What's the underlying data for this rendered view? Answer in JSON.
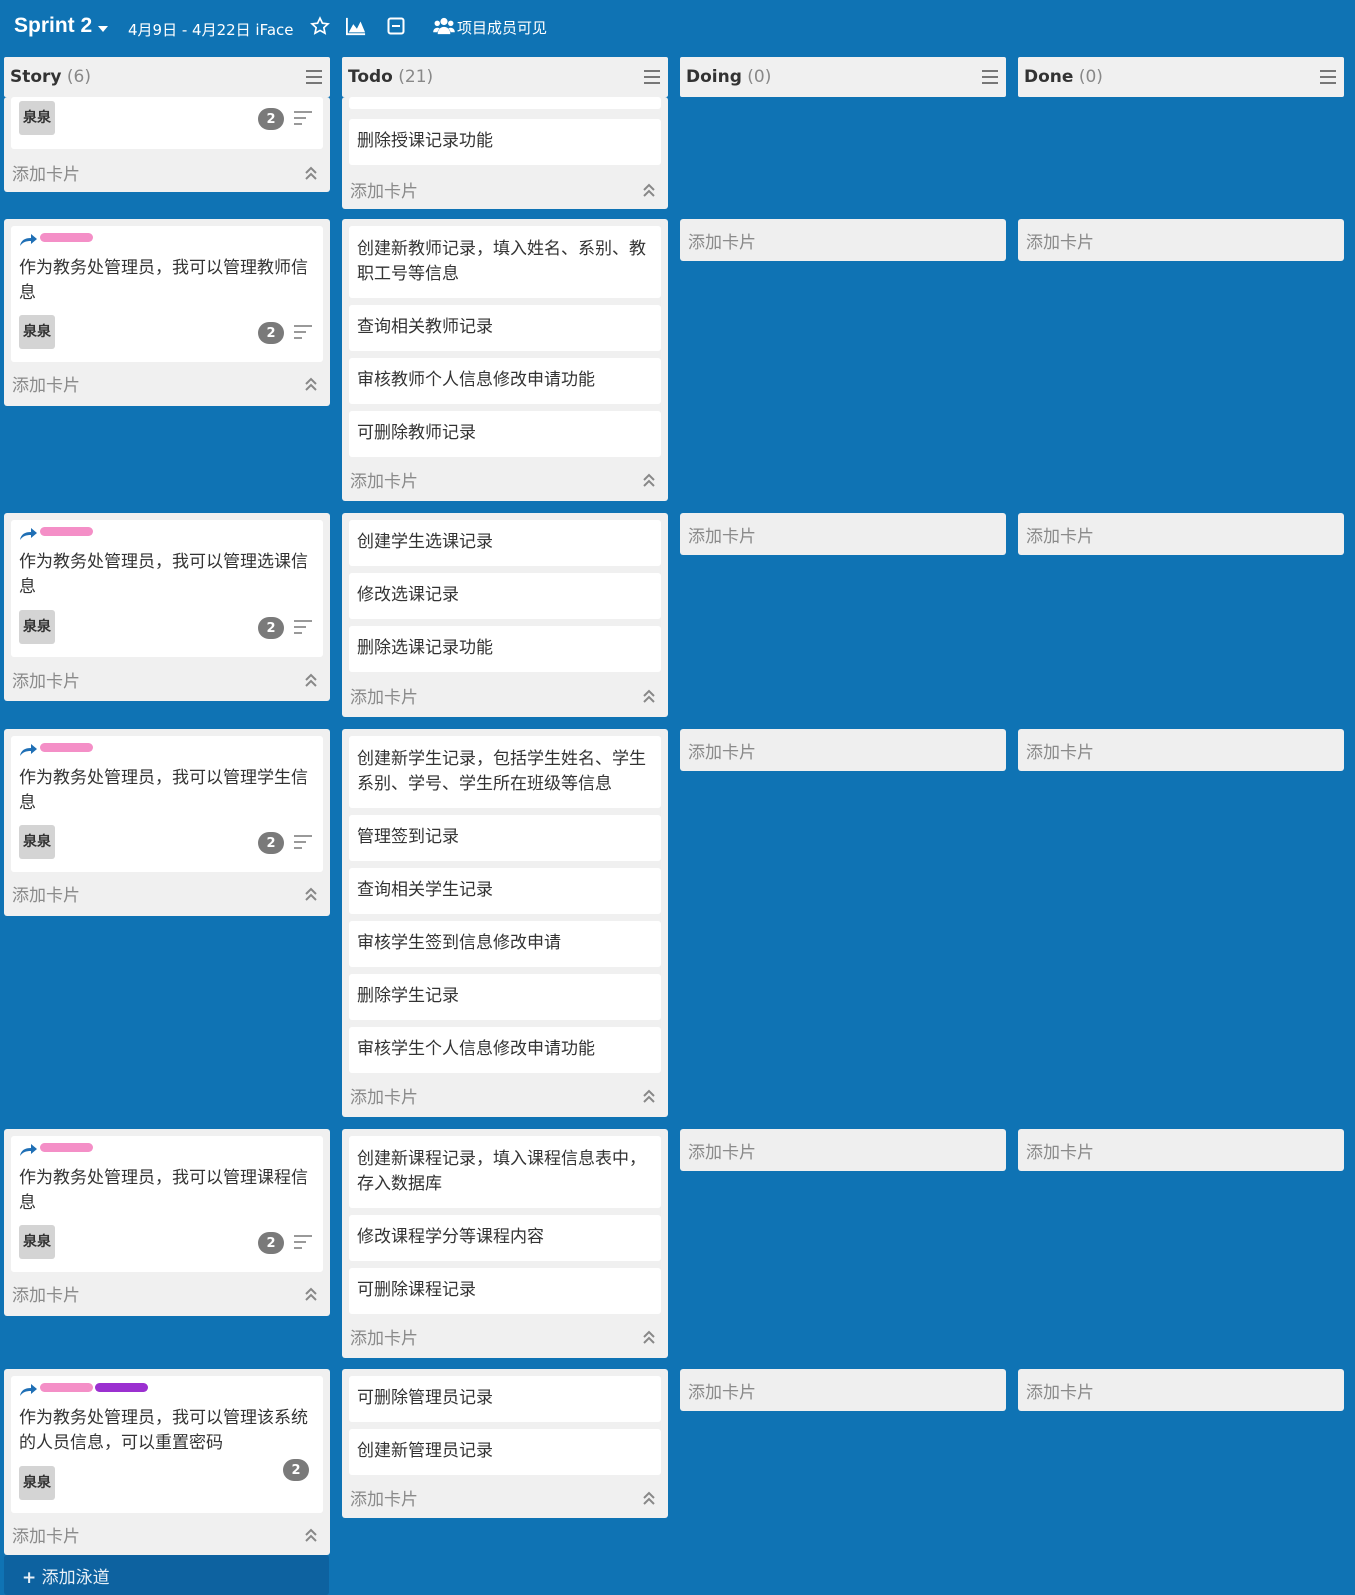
{
  "header": {
    "sprint_title": "Sprint 2",
    "dates": "4月9日 - 4月22日 iFace",
    "visibility_label": "项目成员可见",
    "icons": [
      "chevron-down-icon",
      "star-icon",
      "chart-icon",
      "collapse-icon",
      "team-icon"
    ]
  },
  "columns": [
    {
      "name": "Story",
      "count": "(6)"
    },
    {
      "name": "Todo",
      "count": "(21)"
    },
    {
      "name": "Doing",
      "count": "(0)"
    },
    {
      "name": "Done",
      "count": "(0)"
    }
  ],
  "common": {
    "add_card": "添加卡片",
    "owner": "泉泉",
    "badge_count": "2"
  },
  "swimlanes": [
    {
      "story": {
        "title": ""
      },
      "todo": [
        "删除授课记录功能"
      ]
    },
    {
      "story": {
        "title": "作为教务处管理员，我可以管理教师信息"
      },
      "todo": [
        "创建新教师记录，填入姓名、系别、教职工号等信息",
        "查询相关教师记录",
        "审核教师个人信息修改申请功能",
        "可删除教师记录"
      ]
    },
    {
      "story": {
        "title": "作为教务处管理员，我可以管理选课信息"
      },
      "todo": [
        "创建学生选课记录",
        "修改选课记录",
        "删除选课记录功能"
      ]
    },
    {
      "story": {
        "title": "作为教务处管理员，我可以管理学生信息"
      },
      "todo": [
        "创建新学生记录，包括学生姓名、学生系别、学号、学生所在班级等信息",
        "管理签到记录",
        "查询相关学生记录",
        "审核学生签到信息修改申请",
        "删除学生记录",
        "审核学生个人信息修改申请功能"
      ]
    },
    {
      "story": {
        "title": "作为教务处管理员，我可以管理课程信息"
      },
      "todo": [
        "创建新课程记录，填入课程信息表中，存入数据库",
        "修改课程学分等课程内容",
        "可删除课程记录"
      ]
    },
    {
      "story": {
        "title": "作为教务处管理员，我可以管理该系统的人员信息，可以重置密码"
      },
      "todo": [
        "可删除管理员记录",
        "创建新管理员记录"
      ]
    }
  ],
  "footer": {
    "add_lane": "添加泳道"
  },
  "colors": {
    "background": "#0f73b4",
    "tag_pink": "#f48fc7",
    "tag_purple": "#9b30d0",
    "share_blue": "#1f6fb5"
  }
}
